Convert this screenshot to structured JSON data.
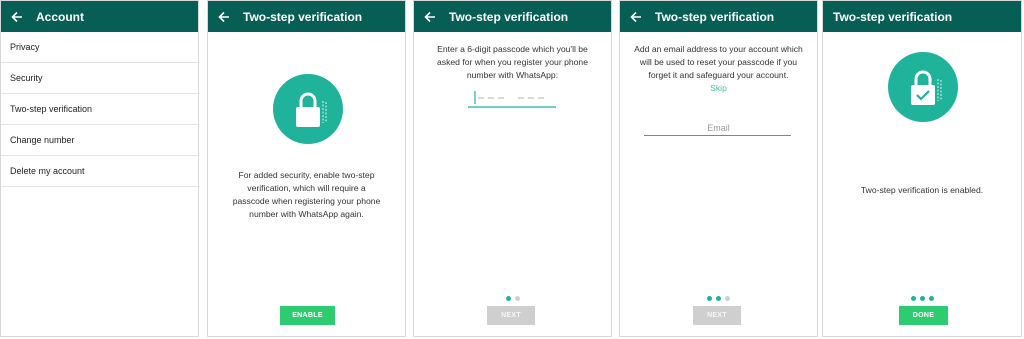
{
  "colors": {
    "appbar": "#075e54",
    "accent": "#1fb39b",
    "button_green": "#2ecc71",
    "button_disabled": "#cfcfcf"
  },
  "panel1": {
    "title": "Account",
    "items": [
      {
        "label": "Privacy"
      },
      {
        "label": "Security"
      },
      {
        "label": "Two-step verification"
      },
      {
        "label": "Change number"
      },
      {
        "label": "Delete my account"
      }
    ]
  },
  "panel2": {
    "title": "Two-step verification",
    "description": "For added security, enable two-step verification, which will require a passcode when registering your phone number with WhatsApp again.",
    "button": "ENABLE",
    "icon": "lock-icon"
  },
  "panel3": {
    "title": "Two-step verification",
    "instruction": "Enter a 6-digit passcode which you'll be asked for when you register your phone number with WhatsApp:",
    "button": "NEXT",
    "step": 1,
    "steps": 2
  },
  "panel4": {
    "title": "Two-step verification",
    "instruction": "Add an email address to your account which will be used to reset your passcode if you forget it and safeguard your account.",
    "skip": "Skip",
    "email_placeholder": "Email",
    "button": "NEXT",
    "step": 2,
    "steps": 3
  },
  "panel5": {
    "title": "Two-step verification",
    "message": "Two-step verification is enabled.",
    "button": "DONE",
    "icon": "lock-check-icon",
    "step": 3,
    "steps": 3
  }
}
